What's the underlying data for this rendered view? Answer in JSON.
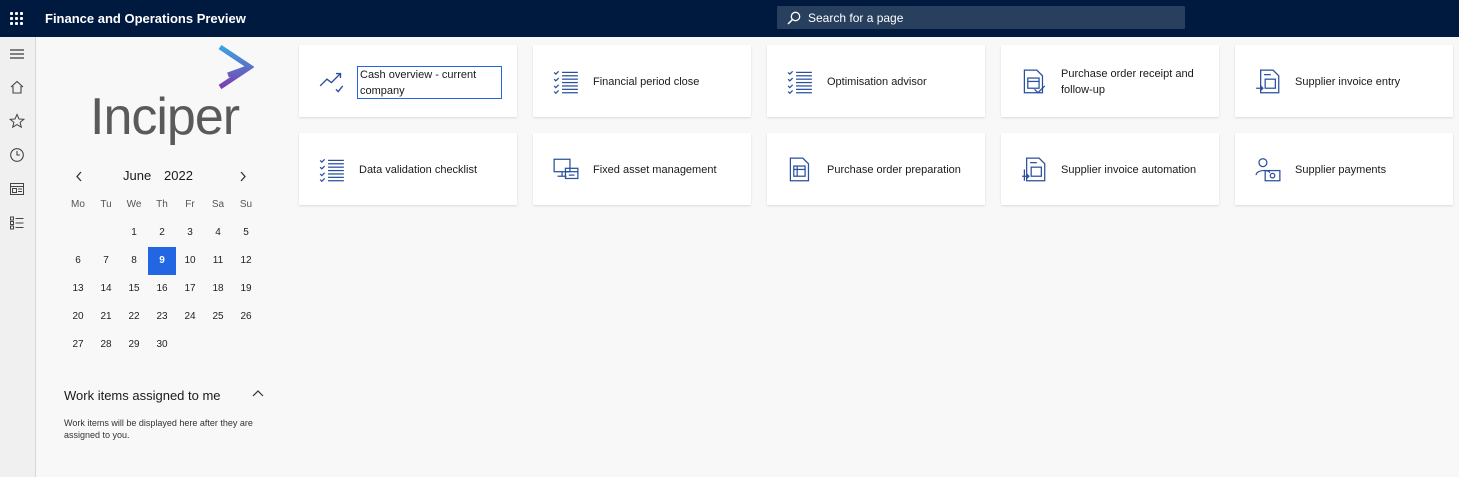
{
  "topbar": {
    "app_title": "Finance and Operations Preview",
    "search_placeholder": "Search for a page",
    "waffle_icon": "waffle-icon",
    "search_icon": "search-icon"
  },
  "navrail": {
    "items": [
      {
        "icon": "hamburger-icon"
      },
      {
        "icon": "home-icon"
      },
      {
        "icon": "star-icon"
      },
      {
        "icon": "clock-icon"
      },
      {
        "icon": "workspace-icon"
      },
      {
        "icon": "list-icon"
      }
    ]
  },
  "logo": {
    "text": "Inciper"
  },
  "calendar": {
    "month": "June",
    "year": "2022",
    "weekdays": [
      "Mo",
      "Tu",
      "We",
      "Th",
      "Fr",
      "Sa",
      "Su"
    ],
    "selected_day": "9",
    "weeks": [
      [
        "",
        "",
        "1",
        "2",
        "3",
        "4",
        "5"
      ],
      [
        "6",
        "7",
        "8",
        "9",
        "10",
        "11",
        "12"
      ],
      [
        "13",
        "14",
        "15",
        "16",
        "17",
        "18",
        "19"
      ],
      [
        "20",
        "21",
        "22",
        "23",
        "24",
        "25",
        "26"
      ],
      [
        "27",
        "28",
        "29",
        "30",
        "",
        "",
        ""
      ]
    ]
  },
  "work_items": {
    "title": "Work items assigned to me",
    "message": "Work items will be displayed here after they are assigned to you."
  },
  "tiles": [
    {
      "label": "Cash overview - current company",
      "icon": "trend-chart-icon"
    },
    {
      "label": "Financial period close",
      "icon": "checklist-icon"
    },
    {
      "label": "Optimisation advisor",
      "icon": "checklist-icon"
    },
    {
      "label": "Purchase order receipt and follow-up",
      "icon": "document-check-icon"
    },
    {
      "label": "Supplier invoice entry",
      "icon": "invoice-entry-icon"
    },
    {
      "label": "Data validation checklist",
      "icon": "checklist-icon"
    },
    {
      "label": "Fixed asset management",
      "icon": "asset-icon"
    },
    {
      "label": "Purchase order preparation",
      "icon": "document-icon"
    },
    {
      "label": "Supplier invoice automation",
      "icon": "invoice-automation-icon"
    },
    {
      "label": "Supplier payments",
      "icon": "payment-person-icon"
    }
  ],
  "colors": {
    "topbar": "#001a3f",
    "accent": "#2266e3",
    "icon": "#2a4f9e"
  }
}
